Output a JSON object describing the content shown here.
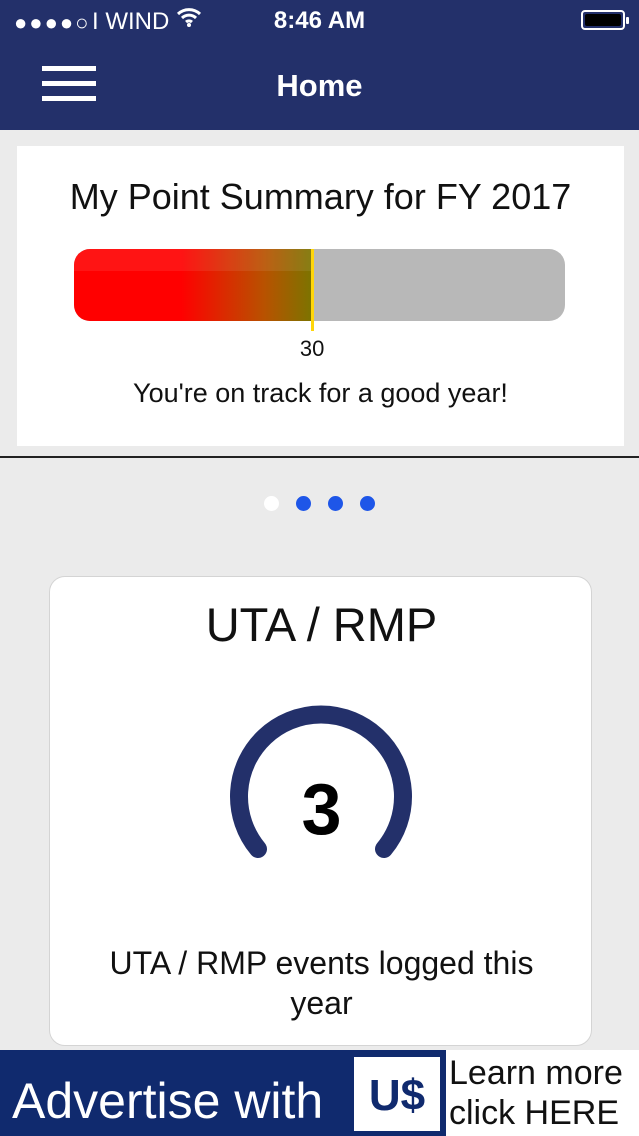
{
  "status_bar": {
    "signal": "●●●●○",
    "carrier": "I WIND",
    "wifi_icon": "wifi-icon",
    "time": "8:46 AM",
    "battery_icon": "battery-icon"
  },
  "nav": {
    "title": "Home",
    "menu_icon": "hamburger-icon"
  },
  "summary": {
    "title": "My Point Summary for FY 2017",
    "points": 30,
    "progress_fraction": 0.485,
    "marker_label": "30",
    "message": "You're on track for a good year!"
  },
  "pager": {
    "count": 4,
    "active_index": 0
  },
  "card": {
    "title": "UTA / RMP",
    "value": "3",
    "caption": "UTA / RMP events logged this year"
  },
  "ad": {
    "text": "Advertise with",
    "logo_text": "U$",
    "cta_line1": "Learn more",
    "cta_line2": "click HERE"
  },
  "colors": {
    "nav_bg": "#23306a",
    "gauge": "#23306a",
    "dot": "#1e56e8",
    "marker": "#ffd60a",
    "ad_bg": "#102a6e"
  }
}
